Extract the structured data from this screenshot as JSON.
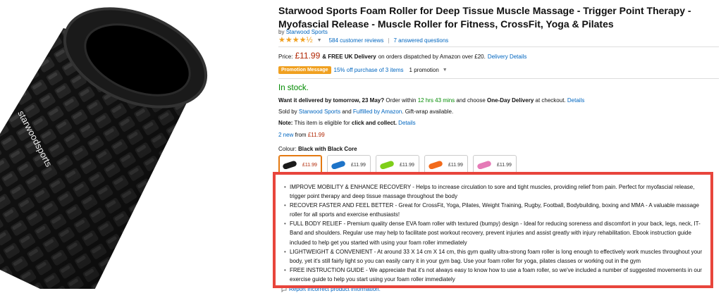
{
  "product": {
    "title": "Starwood Sports Foam Roller for Deep Tissue Muscle Massage - Trigger Point Therapy - Myofascial Release - Muscle Roller for Fitness, CrossFit, Yoga & Pilates",
    "by_prefix": "by",
    "brand": "Starwood Sports",
    "rating": 4.5,
    "rating_stars": "★★★★½",
    "reviews_link": "584 customer reviews",
    "questions_link": "7 answered questions",
    "logo_text": "starwoodsports"
  },
  "price": {
    "label": "Price:",
    "amount": "£11.99",
    "free_delivery": "& FREE UK Delivery",
    "delivery_text": "on orders dispatched by Amazon over £20.",
    "delivery_link": "Delivery Details"
  },
  "promo": {
    "badge": "Promotion Message",
    "offer_link": "15% off purchase of 3 items",
    "count": "1 promotion"
  },
  "availability": {
    "status": "In stock.",
    "delivery_bold": "Want it delivered by tomorrow, 23 May?",
    "order_within": "Order within",
    "countdown": "12 hrs 43 mins",
    "choose": "and choose",
    "one_day": "One-Day Delivery",
    "at_checkout": "at checkout.",
    "details_link": "Details",
    "sold_by_prefix": "Sold by",
    "seller": "Starwood Sports",
    "and": "and",
    "fulfilled": "Fulfilled by Amazon",
    "gift_wrap": ". Gift-wrap available.",
    "note_label": "Note:",
    "note_text": "This item is eligible for",
    "click_collect": "click and collect.",
    "note_link": "Details",
    "new_link": "2 new",
    "new_from": "from",
    "new_price": "£11.99"
  },
  "colour": {
    "label": "Colour:",
    "selected": "Black with Black Core",
    "options": [
      {
        "price": "£11.99",
        "color": "#1b1b1b",
        "selected": true
      },
      {
        "price": "£11.99",
        "color": "#1e74c8",
        "selected": false
      },
      {
        "price": "£11.99",
        "color": "#7fcf1a",
        "selected": false
      },
      {
        "price": "£11.99",
        "color": "#f26a1b",
        "selected": false
      },
      {
        "price": "£11.99",
        "color": "#e57ab7",
        "selected": false
      }
    ]
  },
  "bullets": [
    "IMPROVE MOBILITY & ENHANCE RECOVERY - Helps to increase circulation to sore and tight muscles, providing relief from pain. Perfect for myofascial release, trigger point therapy and deep tissue massage throughout the body",
    "RECOVER FASTER AND FEEL BETTER - Great for CrossFit, Yoga, Pilates, Weight Training, Rugby, Football, Bodybuilding, boxing and MMA - A valuable massage roller for all sports and exercise enthusiasts!",
    "FULL BODY RELIEF - Premium quality dense EVA foam roller with textured (bumpy) design - Ideal for reducing soreness and discomfort in your back, legs, neck, IT-Band and shoulders. Regular use may help to facilitate post workout recovery, prevent injuries and assist greatly with injury rehabilitation. Ebook instruction guide included to help get you started with using your foam roller immediately",
    "LIGHTWEIGHT & CONVENIENT - At around 33 X 14 cm X 14 cm, this gym quality ultra-strong foam roller is long enough to effectively work muscles throughout your body, yet it's still fairly light so you can easily carry it in your gym bag. Use your foam roller for yoga, pilates classes or working out in the gym",
    "FREE INSTRUCTION GUIDE - We appreciate that it's not always easy to know how to use a foam roller, so we've included a number of suggested movements in our exercise guide to help you start using your foam roller immediately"
  ],
  "report_link": "Report incorrect product information.",
  "colors": {
    "link": "#0066c0",
    "price": "#b12704",
    "in_stock": "#008a00",
    "highlight_border": "#e8453c",
    "promo_badge": "#f0a020"
  }
}
